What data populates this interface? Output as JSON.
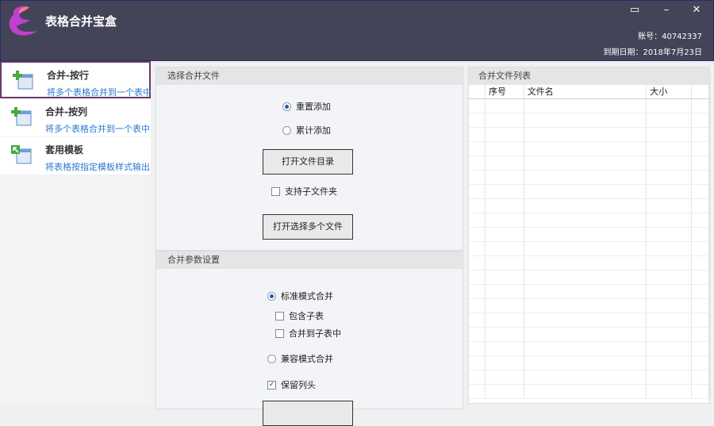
{
  "app": {
    "title": "表格合并宝盒",
    "account_label": "账号：40742337",
    "expiry_label": "到期日期：2018年7月23日",
    "window_buttons": [
      "restore-icon",
      "minimize-icon",
      "close-icon"
    ]
  },
  "sidebar": {
    "items": [
      {
        "title": "合并-按行",
        "subtitle": "将多个表格合并到一个表中",
        "active": true
      },
      {
        "title": "合并-按列",
        "subtitle": "将多个表格合并到一个表中",
        "active": false
      },
      {
        "title": "套用模板",
        "subtitle": "将表格按指定模板样式输出",
        "active": false
      }
    ]
  },
  "select_files": {
    "heading": "选择合并文件",
    "radio_reset": "重置添加",
    "radio_append": "累计添加",
    "open_dir_button": "打开文件目录",
    "include_subfolders": "支持子文件夹",
    "open_files_button": "打开选择多个文件"
  },
  "merge_params": {
    "heading": "合并参数设置",
    "standard_mode": "标准模式合并",
    "include_subsheets": "包含子表",
    "merge_to_subsheet": "合并到子表中",
    "compatible_mode": "兼容模式合并",
    "keep_header": "保留列头"
  },
  "file_list": {
    "heading": "合并文件列表",
    "columns": [
      "",
      "序号",
      "文件名",
      "大小",
      ""
    ]
  }
}
